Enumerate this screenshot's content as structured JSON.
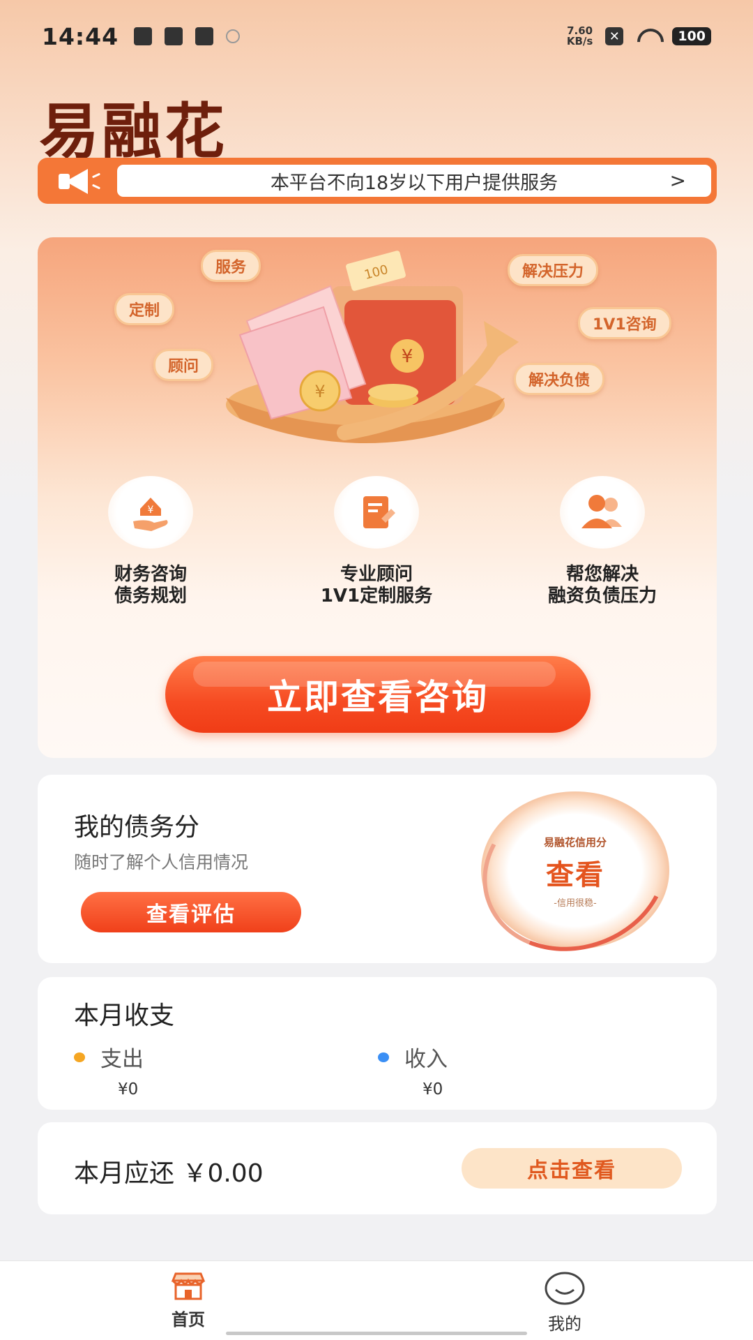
{
  "status_bar": {
    "time": "14:44",
    "net_speed_value": "7.60",
    "net_speed_unit": "KB/s",
    "battery": "100"
  },
  "app": {
    "title": "易融花"
  },
  "notice": {
    "text": "本平台不向18岁以下用户提供服务",
    "chevron": ">"
  },
  "hero": {
    "bubbles": [
      "服务",
      "定制",
      "顾问",
      "解决压力",
      "1V1咨询",
      "解决负债"
    ],
    "ticket_label": "100",
    "features": [
      {
        "line1": "财务咨询",
        "line2": "债务规划",
        "icon": "house-hand-icon"
      },
      {
        "line1": "专业顾问",
        "line2": "1V1定制服务",
        "icon": "document-pen-icon"
      },
      {
        "line1": "帮您解决",
        "line2": "融资负债压力",
        "icon": "people-icon"
      }
    ],
    "cta_label": "立即查看咨询"
  },
  "debt_score": {
    "title": "我的债务分",
    "subtitle": "随时了解个人信用情况",
    "button_label": "查看评估",
    "gauge_label": "易融花信用分",
    "gauge_value": "查看",
    "gauge_note": "-信用很稳-"
  },
  "monthly": {
    "title": "本月收支",
    "expense_label": "支出",
    "expense_amount": "¥0",
    "income_label": "收入",
    "income_amount": "¥0",
    "expense_color": "#f5a623",
    "income_color": "#3b8ff5"
  },
  "repay": {
    "text": "本月应还 ￥0.00",
    "button_label": "点击查看"
  },
  "tabs": [
    {
      "label": "首页",
      "icon": "storefront-icon",
      "active": true
    },
    {
      "label": "我的",
      "icon": "smiley-icon",
      "active": false
    }
  ],
  "colors": {
    "accent": "#f47737",
    "cta": "#f64b22",
    "title": "#6e1f0c"
  }
}
